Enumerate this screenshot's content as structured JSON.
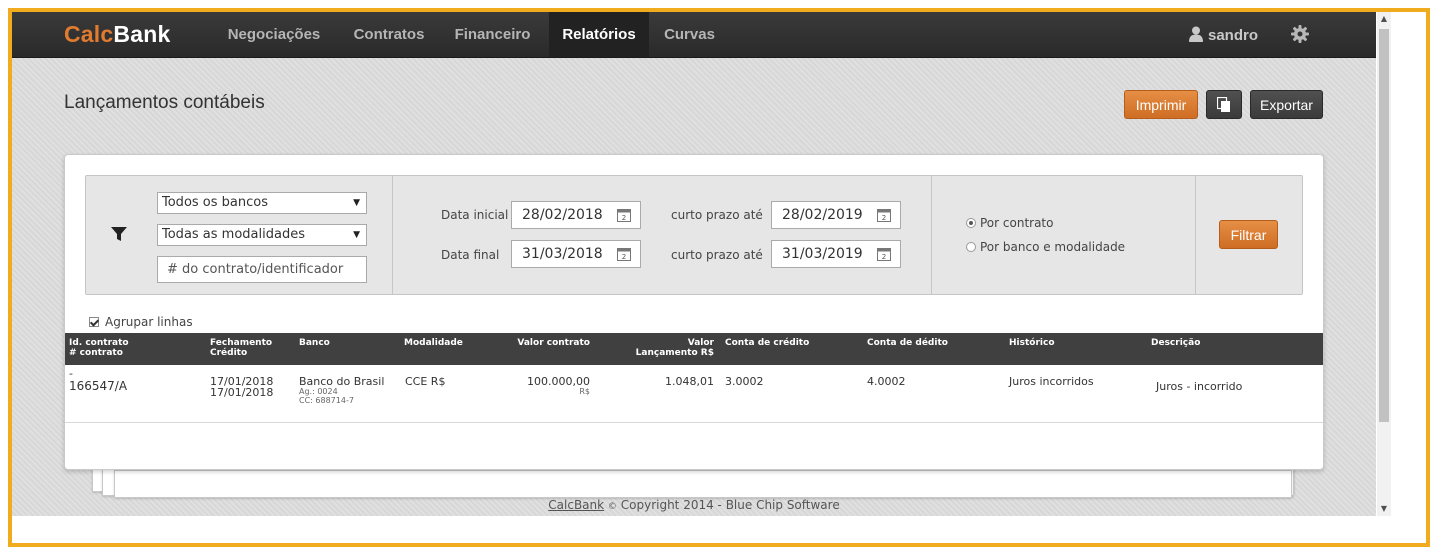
{
  "app": {
    "logo_calc": "Calc",
    "logo_bank": "Bank"
  },
  "nav": {
    "items": [
      "Negociações",
      "Contratos",
      "Financeiro",
      "Relatórios",
      "Curvas"
    ],
    "active": "Relatórios",
    "user": "sandro"
  },
  "page": {
    "title": "Lançamentos contábeis",
    "print_label": "Imprimir",
    "export_label": "Exportar"
  },
  "filter": {
    "bank_select": "Todos os bancos",
    "modality_select": "Todas as modalidades",
    "contract_placeholder": "# do contrato/identificador",
    "start_label": "Data inicial",
    "start_value": "28/02/2018",
    "end_label": "Data final",
    "end_value": "31/03/2018",
    "short_term_label": "curto prazo até",
    "short_term_start": "28/02/2019",
    "short_term_end": "31/03/2019",
    "radio_options": [
      "Por contrato",
      "Por banco e modalidade"
    ],
    "radio_selected": "Por contrato",
    "filter_button": "Filtrar"
  },
  "table": {
    "group_lines_label": "Agrupar linhas",
    "group_lines_checked": true,
    "headers": {
      "id_line1": "Id. contrato",
      "id_line2": "# contrato",
      "closing_line1": "Fechamento",
      "closing_line2": "Crédito",
      "bank": "Banco",
      "modality": "Modalidade",
      "contract_value": "Valor contrato",
      "posting_line1": "Valor",
      "posting_line2": "Lançamento R$",
      "credit_account": "Conta de crédito",
      "debit_account": "Conta de dédito",
      "history": "Histórico",
      "description": "Descrição"
    },
    "rows": [
      {
        "id": "-",
        "contract": "166547/A",
        "closing": "17/01/2018",
        "credit_date": "17/01/2018",
        "bank": "Banco do Brasil",
        "agency": "Ag.: 0024",
        "account": "CC: 688714-7",
        "modality": "CCE R$",
        "contract_value": "100.000,00",
        "currency": "R$",
        "posting_value": "1.048,01",
        "credit_account": "3.0002",
        "debit_account": "4.0002",
        "history": "Juros incorridos",
        "description": "Juros - incorrido"
      }
    ]
  },
  "footer": {
    "link": "CalcBank",
    "copyright_symbol": "©",
    "text": "Copyright 2014 - Blue Chip Software"
  },
  "colors": {
    "accent": "#e07b2f",
    "nav_bg": "#333333",
    "frame": "#f0ab1e"
  },
  "icons": [
    "user-icon",
    "gear-icon",
    "copy-icon",
    "filter-icon",
    "calendar-icon"
  ]
}
